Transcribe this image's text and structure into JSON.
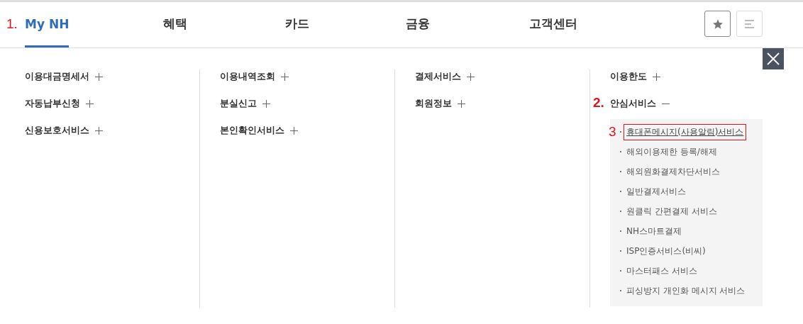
{
  "tabs": [
    {
      "label": "My NH",
      "selected": true,
      "annotation": "1."
    },
    {
      "label": "혜택",
      "selected": false
    },
    {
      "label": "카드",
      "selected": false
    },
    {
      "label": "금융",
      "selected": false
    },
    {
      "label": "고객센터",
      "selected": false
    }
  ],
  "columns": [
    {
      "items": [
        {
          "label": "이용대금명세서",
          "expanded": false
        },
        {
          "label": "자동납부신청",
          "expanded": false
        },
        {
          "label": "신용보호서비스",
          "expanded": false
        }
      ]
    },
    {
      "items": [
        {
          "label": "이용내역조회",
          "expanded": false
        },
        {
          "label": "분실신고",
          "expanded": false
        },
        {
          "label": "본인확인서비스",
          "expanded": false
        }
      ]
    },
    {
      "items": [
        {
          "label": "결제서비스",
          "expanded": false
        },
        {
          "label": "회원정보",
          "expanded": false
        }
      ]
    },
    {
      "items": [
        {
          "label": "이용한도",
          "expanded": false
        },
        {
          "label": "안심서비스",
          "expanded": true,
          "annotation": "2.",
          "children": [
            {
              "label": "휴대폰메시지(사용알림)서비스",
              "highlighted": true,
              "annotation": "3"
            },
            {
              "label": "해외이용제한 등록/해제",
              "highlighted": false
            },
            {
              "label": "해외원화결제차단서비스",
              "highlighted": false
            },
            {
              "label": "일반결제서비스",
              "highlighted": false
            },
            {
              "label": "원클릭 간편결제 서비스",
              "highlighted": false
            },
            {
              "label": "NH스마트결제",
              "highlighted": false
            },
            {
              "label": "ISP인증서비스(비씨)",
              "highlighted": false
            },
            {
              "label": "마스터패스 서비스",
              "highlighted": false
            },
            {
              "label": "피싱방지 개인화 메시지 서비스",
              "highlighted": false
            }
          ]
        }
      ]
    }
  ]
}
